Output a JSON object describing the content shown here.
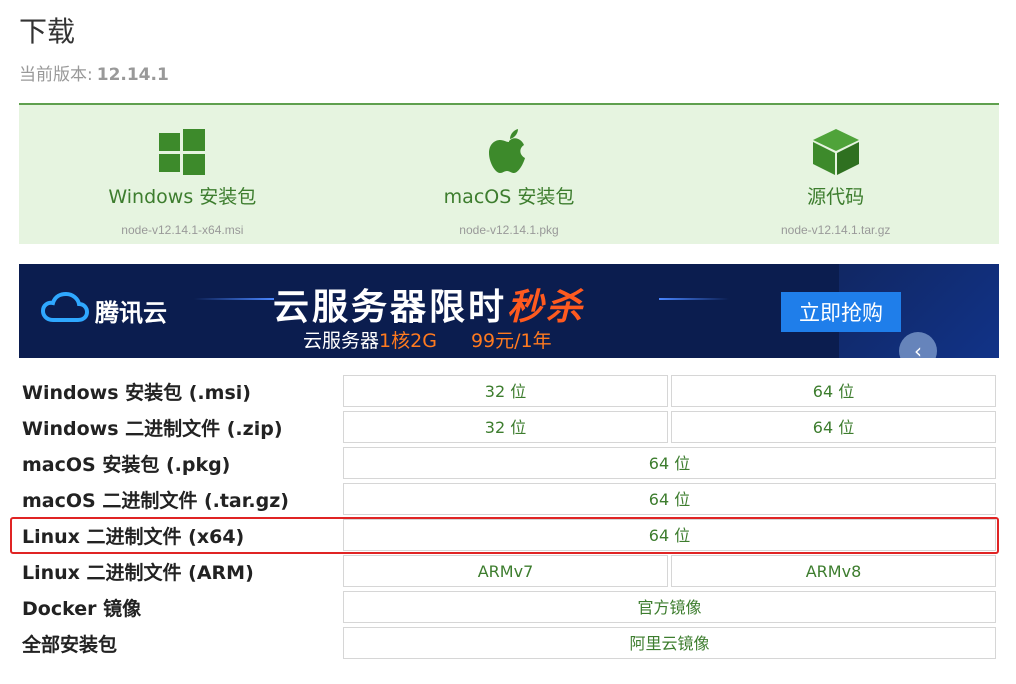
{
  "page": {
    "title": "下载",
    "version_label": "当前版本:",
    "version_value": "12.14.1"
  },
  "downloads": [
    {
      "label": "Windows 安装包",
      "file": "node-v12.14.1-x64.msi",
      "icon": "windows-icon"
    },
    {
      "label": "macOS 安装包",
      "file": "node-v12.14.1.pkg",
      "icon": "apple-icon"
    },
    {
      "label": "源代码",
      "file": "node-v12.14.1.tar.gz",
      "icon": "box-icon"
    }
  ],
  "banner": {
    "brand": "腾讯云",
    "headline_main": "云服务器限时",
    "headline_highlight": "秒杀",
    "sub_main": "云服务器",
    "sub_spec": "1核2G",
    "sub_price": "99元/1年",
    "buy_label": "立即抢购"
  },
  "table": {
    "rows": [
      {
        "label": "Windows 安装包 (.msi)",
        "cells": [
          "32 位",
          "64 位"
        ]
      },
      {
        "label": "Windows 二进制文件 (.zip)",
        "cells": [
          "32 位",
          "64 位"
        ]
      },
      {
        "label": "macOS 安装包 (.pkg)",
        "cells": [
          "64 位"
        ]
      },
      {
        "label": "macOS 二进制文件 (.tar.gz)",
        "cells": [
          "64 位"
        ]
      },
      {
        "label": "Linux 二进制文件 (x64)",
        "cells": [
          "64 位"
        ]
      },
      {
        "label": "Linux 二进制文件 (ARM)",
        "cells": [
          "ARMv7",
          "ARMv8"
        ]
      },
      {
        "label": "Docker 镜像",
        "cells": [
          "官方镜像"
        ]
      },
      {
        "label": "全部安装包",
        "cells": [
          "阿里云镜像"
        ]
      }
    ]
  },
  "colors": {
    "accent_green": "#3d7d2e",
    "panel_bg": "#e6f4e0",
    "highlight_red": "#e02424",
    "banner_bg": "#0b1d4f"
  }
}
